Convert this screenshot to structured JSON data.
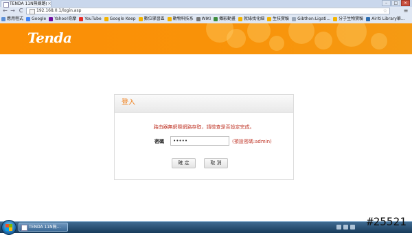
{
  "browser": {
    "tab_title": "TENDA 11N無線路由...",
    "tab_close": "×",
    "url": "192.168.0.1/login.asp",
    "back": "←",
    "forward": "→",
    "reload": "C",
    "star": "☆",
    "menu": "≡",
    "window_controls": {
      "minimize": "–",
      "maximize": "□",
      "close": "×"
    },
    "bookmarks": [
      {
        "label": "應用程式",
        "color": "#5b8fd6"
      },
      {
        "label": "Google",
        "color": "#4285f4"
      },
      {
        "label": "Yahoo!奇摩",
        "color": "#720e9e"
      },
      {
        "label": "YouTube",
        "color": "#e52d27"
      },
      {
        "label": "Google Keep",
        "color": "#f4b400"
      },
      {
        "label": "數位學習區",
        "color": "#f4b400"
      },
      {
        "label": "動物科技系",
        "color": "#f4b400"
      },
      {
        "label": "WIKI",
        "color": "#777777"
      },
      {
        "label": "攝影動畫",
        "color": "#3c8d3c"
      },
      {
        "label": "就綠找化細",
        "color": "#f4b400"
      },
      {
        "label": "生技實驗",
        "color": "#f4b400"
      },
      {
        "label": "Gibthon:Ligati...",
        "color": "#9aa7b8"
      },
      {
        "label": "分子生物實驗",
        "color": "#f4b400"
      },
      {
        "label": "Airiti Library華...",
        "color": "#2b6cb0"
      }
    ]
  },
  "header": {
    "brand": "Tenda",
    "brand_color": "#ffffff",
    "accent": "#fb8f06"
  },
  "login": {
    "title": "登入",
    "message": "路由器無網際網路存取，請檢查是否設定完成。",
    "password_label": "密碼",
    "password_value": "•••••",
    "password_hint": "(預設密碼:admin)",
    "ok_label": "確 定",
    "cancel_label": "取 消"
  },
  "taskbar": {
    "item_label": "TENDA 11N無..."
  },
  "watermark": "#25521"
}
